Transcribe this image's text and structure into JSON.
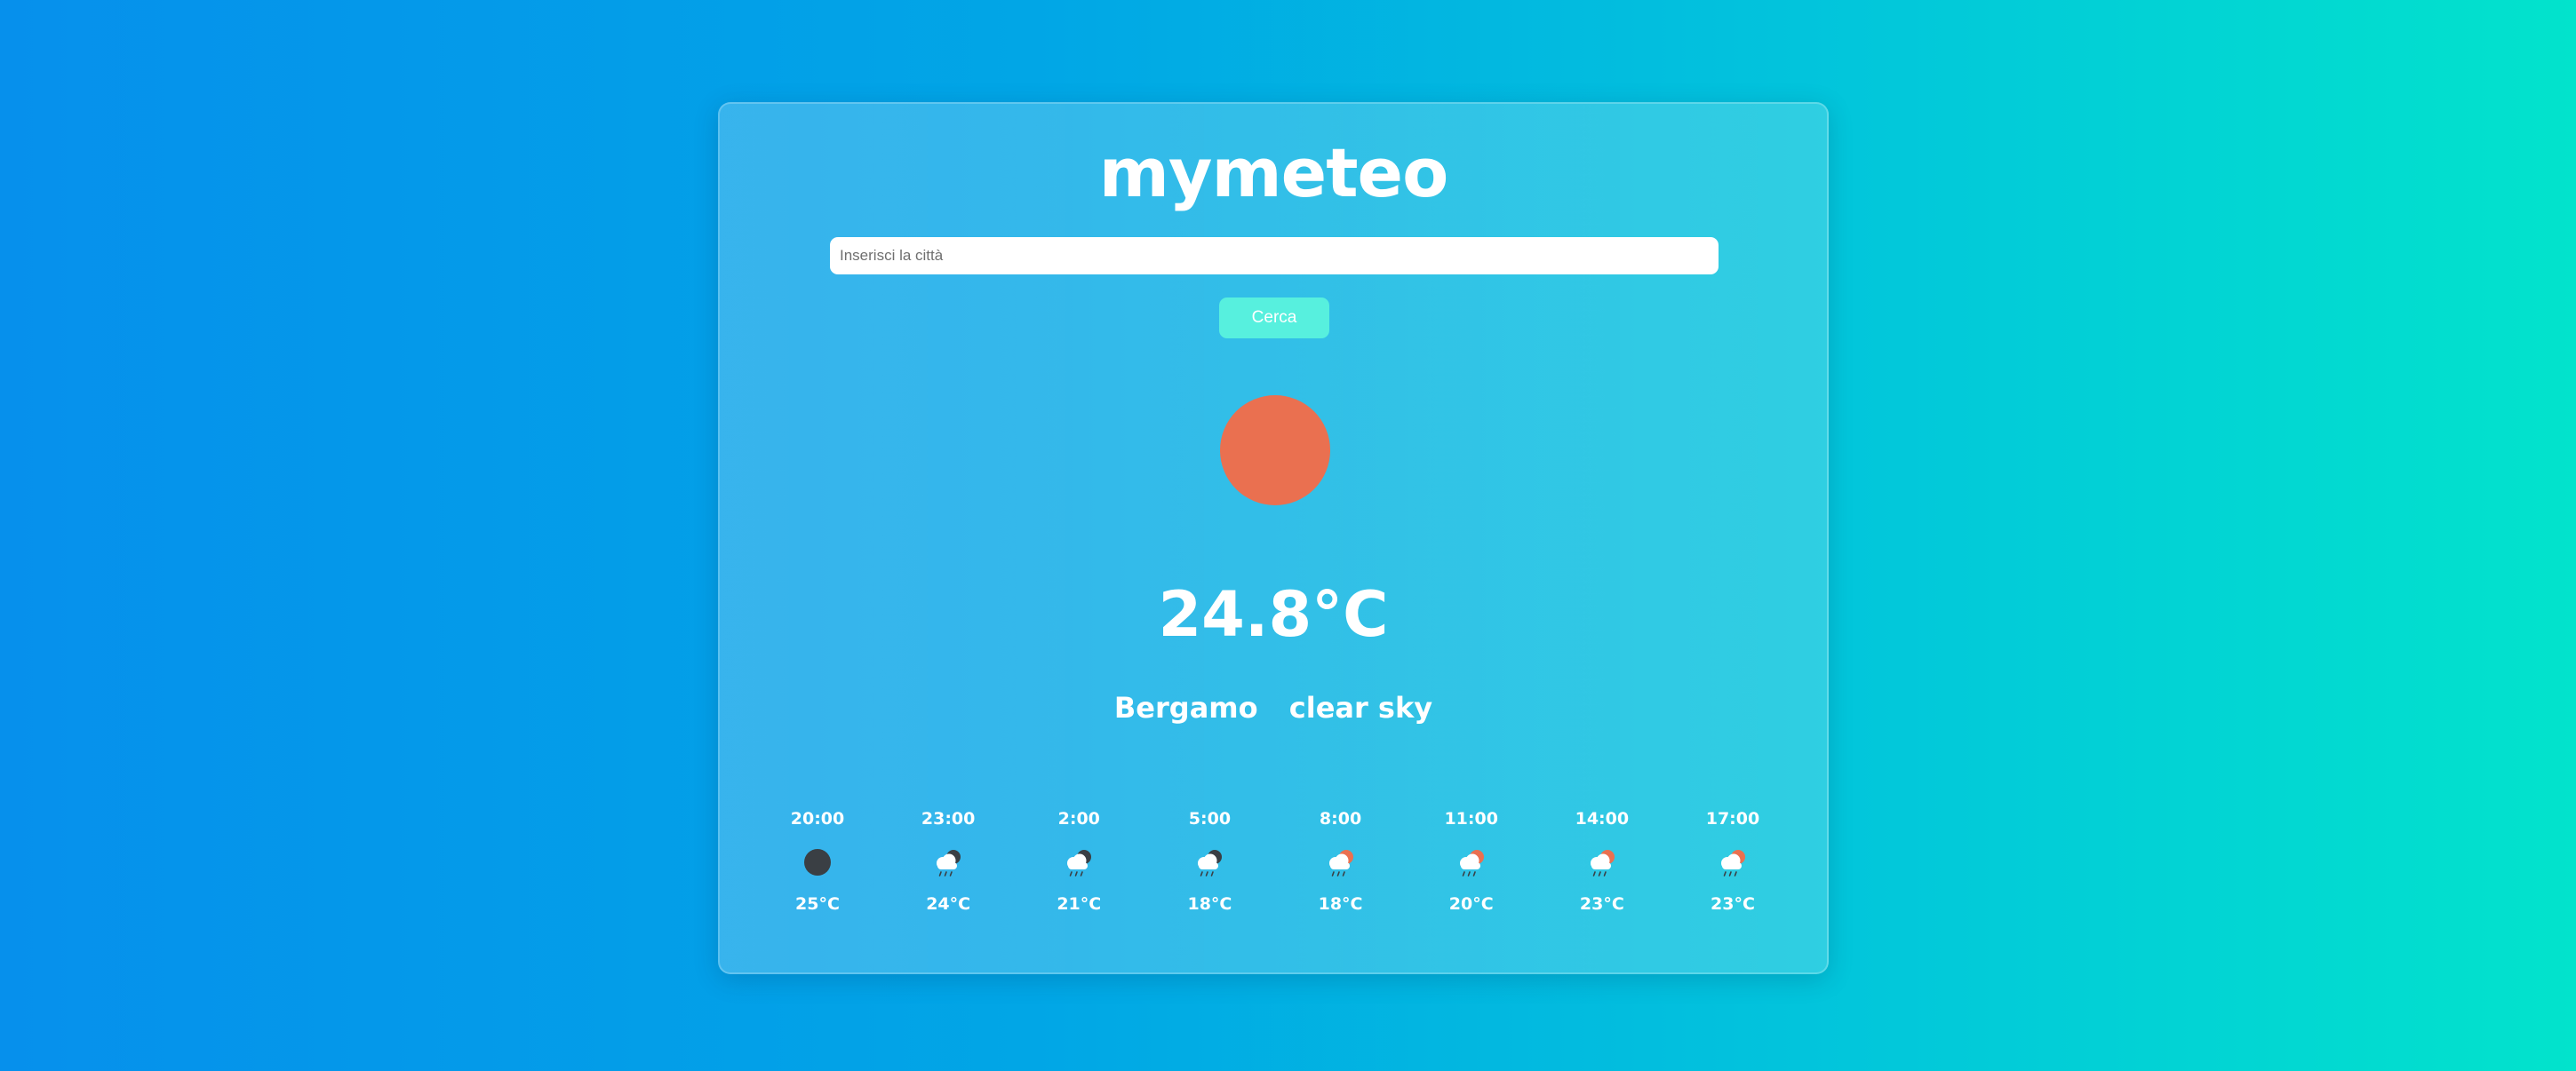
{
  "app": {
    "title": "mymeteo"
  },
  "search": {
    "placeholder": "Inserisci la città",
    "value": "",
    "button_label": "Cerca"
  },
  "current": {
    "icon": "sun-icon",
    "icon_color": "#ea7050",
    "temperature": "24.8°C",
    "city": "Bergamo",
    "description": "clear sky"
  },
  "forecast": [
    {
      "time": "20:00",
      "icon": "moon-icon",
      "temp": "25°C"
    },
    {
      "time": "23:00",
      "icon": "night-rain-icon",
      "temp": "24°C"
    },
    {
      "time": "2:00",
      "icon": "night-rain-icon",
      "temp": "21°C"
    },
    {
      "time": "5:00",
      "icon": "night-rain-icon",
      "temp": "18°C"
    },
    {
      "time": "8:00",
      "icon": "day-rain-icon",
      "temp": "18°C"
    },
    {
      "time": "11:00",
      "icon": "day-rain-icon",
      "temp": "20°C"
    },
    {
      "time": "14:00",
      "icon": "day-rain-icon",
      "temp": "23°C"
    },
    {
      "time": "17:00",
      "icon": "day-rain-icon",
      "temp": "23°C"
    }
  ],
  "colors": {
    "background_start": "#0690ec",
    "background_end": "#02e3cc",
    "button": "#57f0de",
    "sun": "#ea7050",
    "moon": "#3a3f44",
    "cloud": "#ffffff"
  }
}
